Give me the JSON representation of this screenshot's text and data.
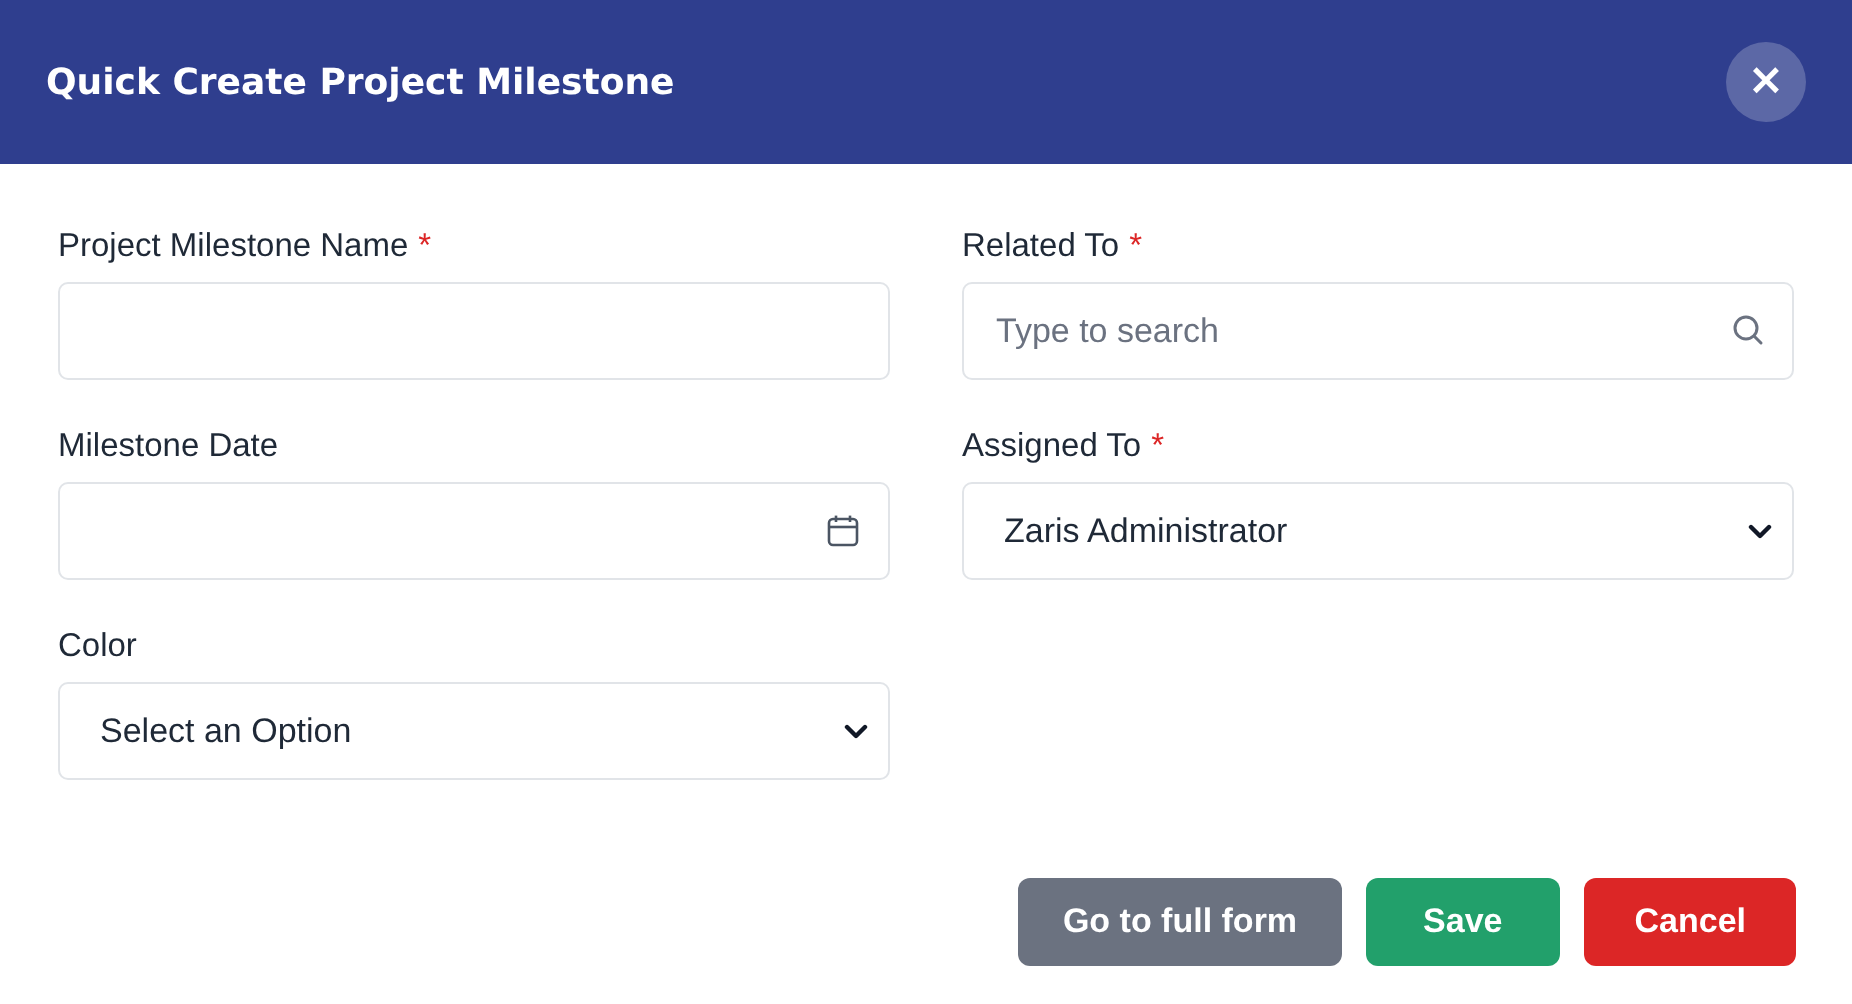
{
  "dialog": {
    "title": "Quick Create Project Milestone",
    "close": "×"
  },
  "fields": [
    {
      "kind": "text",
      "label": "Project Milestone Name",
      "required_mark": "*"
    },
    {
      "kind": "search",
      "label": "Related To",
      "required_mark": "*",
      "placeholder": "Type to search"
    },
    {
      "kind": "date",
      "label": "Milestone Date"
    },
    {
      "kind": "select",
      "label": "Assigned To",
      "required_mark": "*",
      "value": "Zaris Administrator"
    },
    {
      "kind": "select",
      "label": "Color",
      "value": "Select an Option"
    }
  ],
  "buttons": [
    {
      "kind": "secondary",
      "label": "Go to full form"
    },
    {
      "kind": "success",
      "label": "Save"
    },
    {
      "kind": "danger",
      "label": "Cancel"
    }
  ]
}
